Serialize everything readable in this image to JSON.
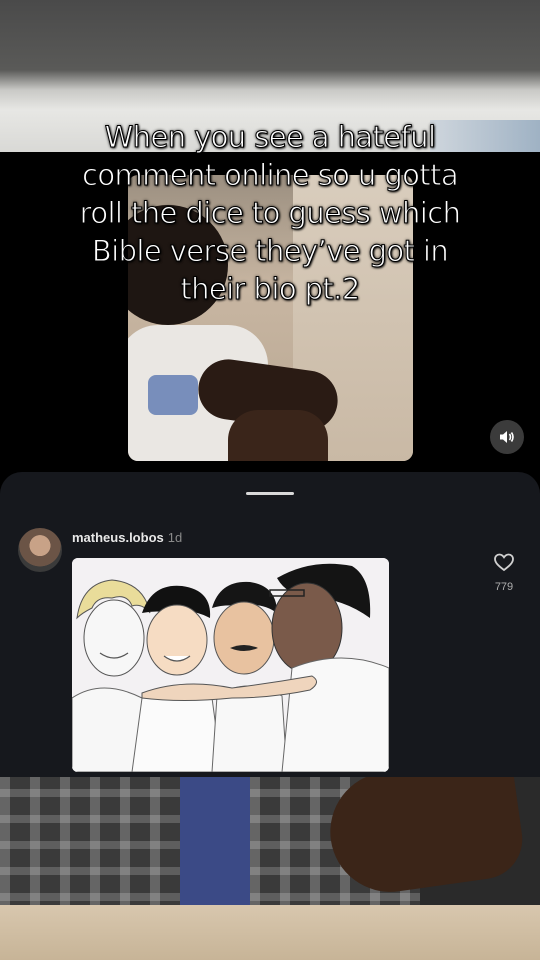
{
  "caption": {
    "line1": "When you see a hateful",
    "line2": "comment online so u gotta",
    "line3": "roll the dice to guess which",
    "line4": "Bible verse they’ve got in",
    "line5": "their bio pt.2"
  },
  "comment": {
    "username": "matheus.lobos",
    "time": "1d",
    "likes": "779"
  },
  "icons": {
    "volume": "volume-icon",
    "like": "heart-icon"
  },
  "colors": {
    "sheet_bg": "#16181d",
    "caption_text": "#ffffff"
  }
}
